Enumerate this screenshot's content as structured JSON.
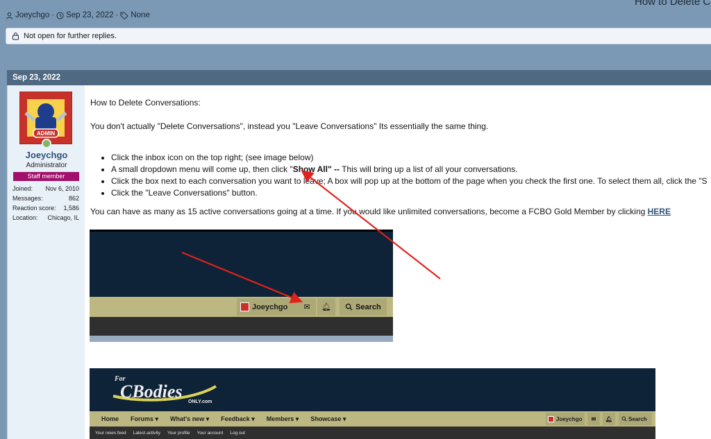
{
  "page": {
    "title": "How to Delete Co"
  },
  "thread_meta": {
    "author": "Joeychgo",
    "date": "Sep 23, 2022",
    "tags": "None"
  },
  "notice": {
    "text": "Not open for further replies."
  },
  "post": {
    "date": "Sep 23, 2022",
    "user": {
      "avatar_text": "ADMIN",
      "name": "Joeychgo",
      "title": "Administrator",
      "badge": "Staff member",
      "stats": [
        {
          "label": "Joined:",
          "value": "Nov 6, 2010"
        },
        {
          "label": "Messages:",
          "value": "862"
        },
        {
          "label": "Reaction score:",
          "value": "1,586"
        },
        {
          "label": "Location:",
          "value": "Chicago, IL"
        }
      ]
    },
    "content": {
      "title": "How to Delete Conversations:",
      "intro": "You don't actually \"Delete Conversations\", instead you \"Leave Conversations\" Its essentially the same thing.",
      "list": {
        "item1": "Click the inbox icon on the top right; (see image below)",
        "item2_pre": "A small dropdown menu will come up, then click \"",
        "item2_bold": "Show All\" --",
        "item2_post": " This will bring up a list of all your conversations.",
        "item3": "Click the box next to each conversation you want to leave; A box will pop up at the bottom of the page when you check the first one. To select them all, click the \"S",
        "item4": "Click the \"Leave Conversations\" button."
      },
      "outro_text": "You can have as many as 15 active conversations going at a time. If you would like unlimited conversations, become a FCBO Gold Member by clicking ",
      "outro_link": "HERE"
    },
    "screenshot1": {
      "user": "Joeychgo",
      "search": "Search"
    },
    "screenshot2": {
      "logo_small": "For",
      "logo_main": "CBodies",
      "logo_sub": "ONLY.com",
      "nav": [
        "Home",
        "Forums ▾",
        "What's new ▾",
        "Feedback ▾",
        "Members ▾",
        "Showcase ▾"
      ],
      "user": "Joeychgo",
      "search": "Search",
      "subnav": [
        "Your news feed",
        "Latest activity",
        "Your profile",
        "Your account",
        "Log out"
      ]
    }
  },
  "colors": {
    "page_bg": "#7b98b4",
    "header_bg": "#4f6983",
    "badge": "#a1106a",
    "arrow": "#e0221c",
    "link": "#2f5278"
  }
}
